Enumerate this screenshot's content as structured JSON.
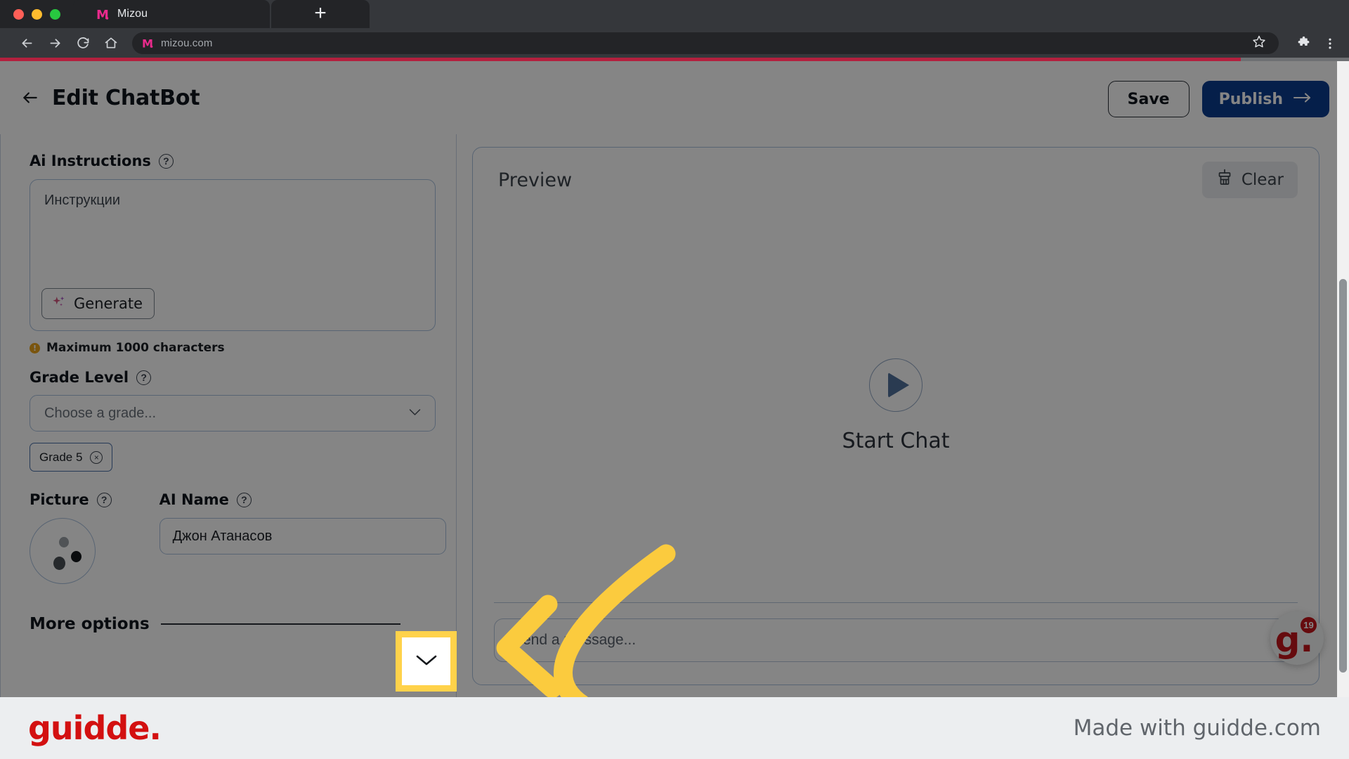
{
  "browser": {
    "tab": {
      "title": "Mizou",
      "favicon": "mizou-m-logo"
    },
    "new_tab_label": "+",
    "omnibox": {
      "url": "mizou.com",
      "favicon": "mizou-m-logo"
    },
    "icons": [
      "back-icon",
      "forward-icon",
      "reload-icon",
      "home-icon",
      "bookmark-star-icon",
      "extensions-puzzle-icon",
      "browser-menu-icon"
    ],
    "loading_progress_percent": 92
  },
  "app": {
    "back_label": "←",
    "title": "Edit ChatBot",
    "save_label": "Save",
    "publish_label": "Publish",
    "publish_arrow": "→"
  },
  "form": {
    "ai_instructions": {
      "label": "Ai Instructions",
      "help": "?",
      "placeholder": "Инструкции",
      "generate_label": "Generate",
      "note": "Maximum 1000 characters",
      "note_badge": "!"
    },
    "grade_level": {
      "label": "Grade Level",
      "help": "?",
      "placeholder": "Choose a grade...",
      "chips": [
        {
          "label": "Grade 5",
          "remove": "×"
        }
      ]
    },
    "picture": {
      "label": "Picture",
      "help": "?"
    },
    "ai_name": {
      "label": "AI Name",
      "help": "?",
      "value": "Джон Атанасов"
    },
    "more_options": {
      "label": "More options",
      "chevron": "chevron-down-icon"
    }
  },
  "preview": {
    "title": "Preview",
    "clear_label": "Clear",
    "clear_icon": "brush-icon",
    "start_chat_label": "Start Chat",
    "play_icon": "play-icon",
    "message_placeholder": "Send a message..."
  },
  "guidde_badge": {
    "letter": "g.",
    "count": "19"
  },
  "footer": {
    "logo": "guidde.",
    "made_with": "Made with guidde.com"
  },
  "colors": {
    "accent_publish": "#0b3c8f",
    "highlight": "#ffd24a",
    "arrow": "#fbcb3e",
    "brand_pink": "#ea2a8c",
    "guidde_red": "#d31010",
    "loading_bar": "#b3203e"
  }
}
